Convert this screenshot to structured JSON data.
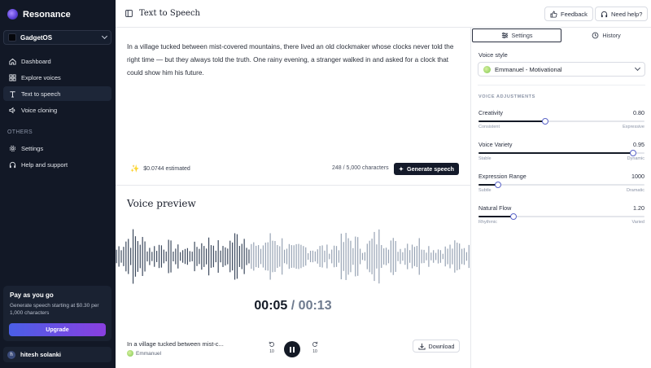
{
  "app": {
    "name": "Resonance"
  },
  "workspace": {
    "name": "GadgetOS"
  },
  "nav": {
    "items": [
      {
        "label": "Dashboard",
        "icon": "home-icon",
        "active": false
      },
      {
        "label": "Explore voices",
        "icon": "grid-icon",
        "active": false
      },
      {
        "label": "Text to speech",
        "icon": "type-icon",
        "active": true
      },
      {
        "label": "Voice cloning",
        "icon": "speaker-icon",
        "active": false
      }
    ],
    "others_label": "OTHERS",
    "others": [
      {
        "label": "Settings",
        "icon": "gear-icon"
      },
      {
        "label": "Help and support",
        "icon": "headphones-icon"
      }
    ]
  },
  "promo": {
    "title": "Pay as you go",
    "text": "Generate speech starting at $0.30 per 1,000 characters",
    "button": "Upgrade"
  },
  "user": {
    "initial": "h",
    "name": "hitesh solanki"
  },
  "header": {
    "title": "Text to Speech",
    "feedback": "Feedback",
    "help": "Need help?"
  },
  "editor": {
    "text": "In a village tucked between mist-covered mountains, there lived an old clockmaker whose clocks never told the right time — but they always told the truth. One rainy evening, a stranger walked in and asked for a clock that could show him his future.",
    "cost": "$0.0744 estimated",
    "chars": "248 / 5,000 characters",
    "generate": "Generate speech"
  },
  "preview": {
    "title": "Voice preview",
    "current": "00:05",
    "separator": "/",
    "total": "00:13",
    "progress_fraction": 0.38,
    "track_title": "In a village tucked between mist-c...",
    "track_voice": "Emmanuel",
    "skip_back": "10",
    "skip_forward": "10",
    "download": "Download"
  },
  "right_panel": {
    "tabs": [
      {
        "label": "Settings",
        "icon": "sliders-icon",
        "active": true
      },
      {
        "label": "History",
        "icon": "history-icon",
        "active": false
      }
    ],
    "voice_style_label": "Voice style",
    "voice_style_value": "Emmanuel - Motivational",
    "adjustments_label": "VOICE ADJUSTMENTS",
    "adjustments": [
      {
        "label": "Creativity",
        "value": "0.80",
        "level": 0.4,
        "min_label": "Consistent",
        "max_label": "Expressive"
      },
      {
        "label": "Voice Variety",
        "value": "0.95",
        "level": 0.93,
        "min_label": "Stable",
        "max_label": "Dynamic"
      },
      {
        "label": "Expression Range",
        "value": "1000",
        "level": 0.12,
        "min_label": "Subtle",
        "max_label": "Dramatic"
      },
      {
        "label": "Natural Flow",
        "value": "1.20",
        "level": 0.21,
        "min_label": "Rhythmic",
        "max_label": "Varied"
      }
    ]
  },
  "colors": {
    "sidebar_bg": "#121826",
    "accent": "#5a64c8",
    "dark_button": "#141a2a",
    "upgrade_from": "#4a5fe6",
    "upgrade_to": "#8a3fe0"
  }
}
